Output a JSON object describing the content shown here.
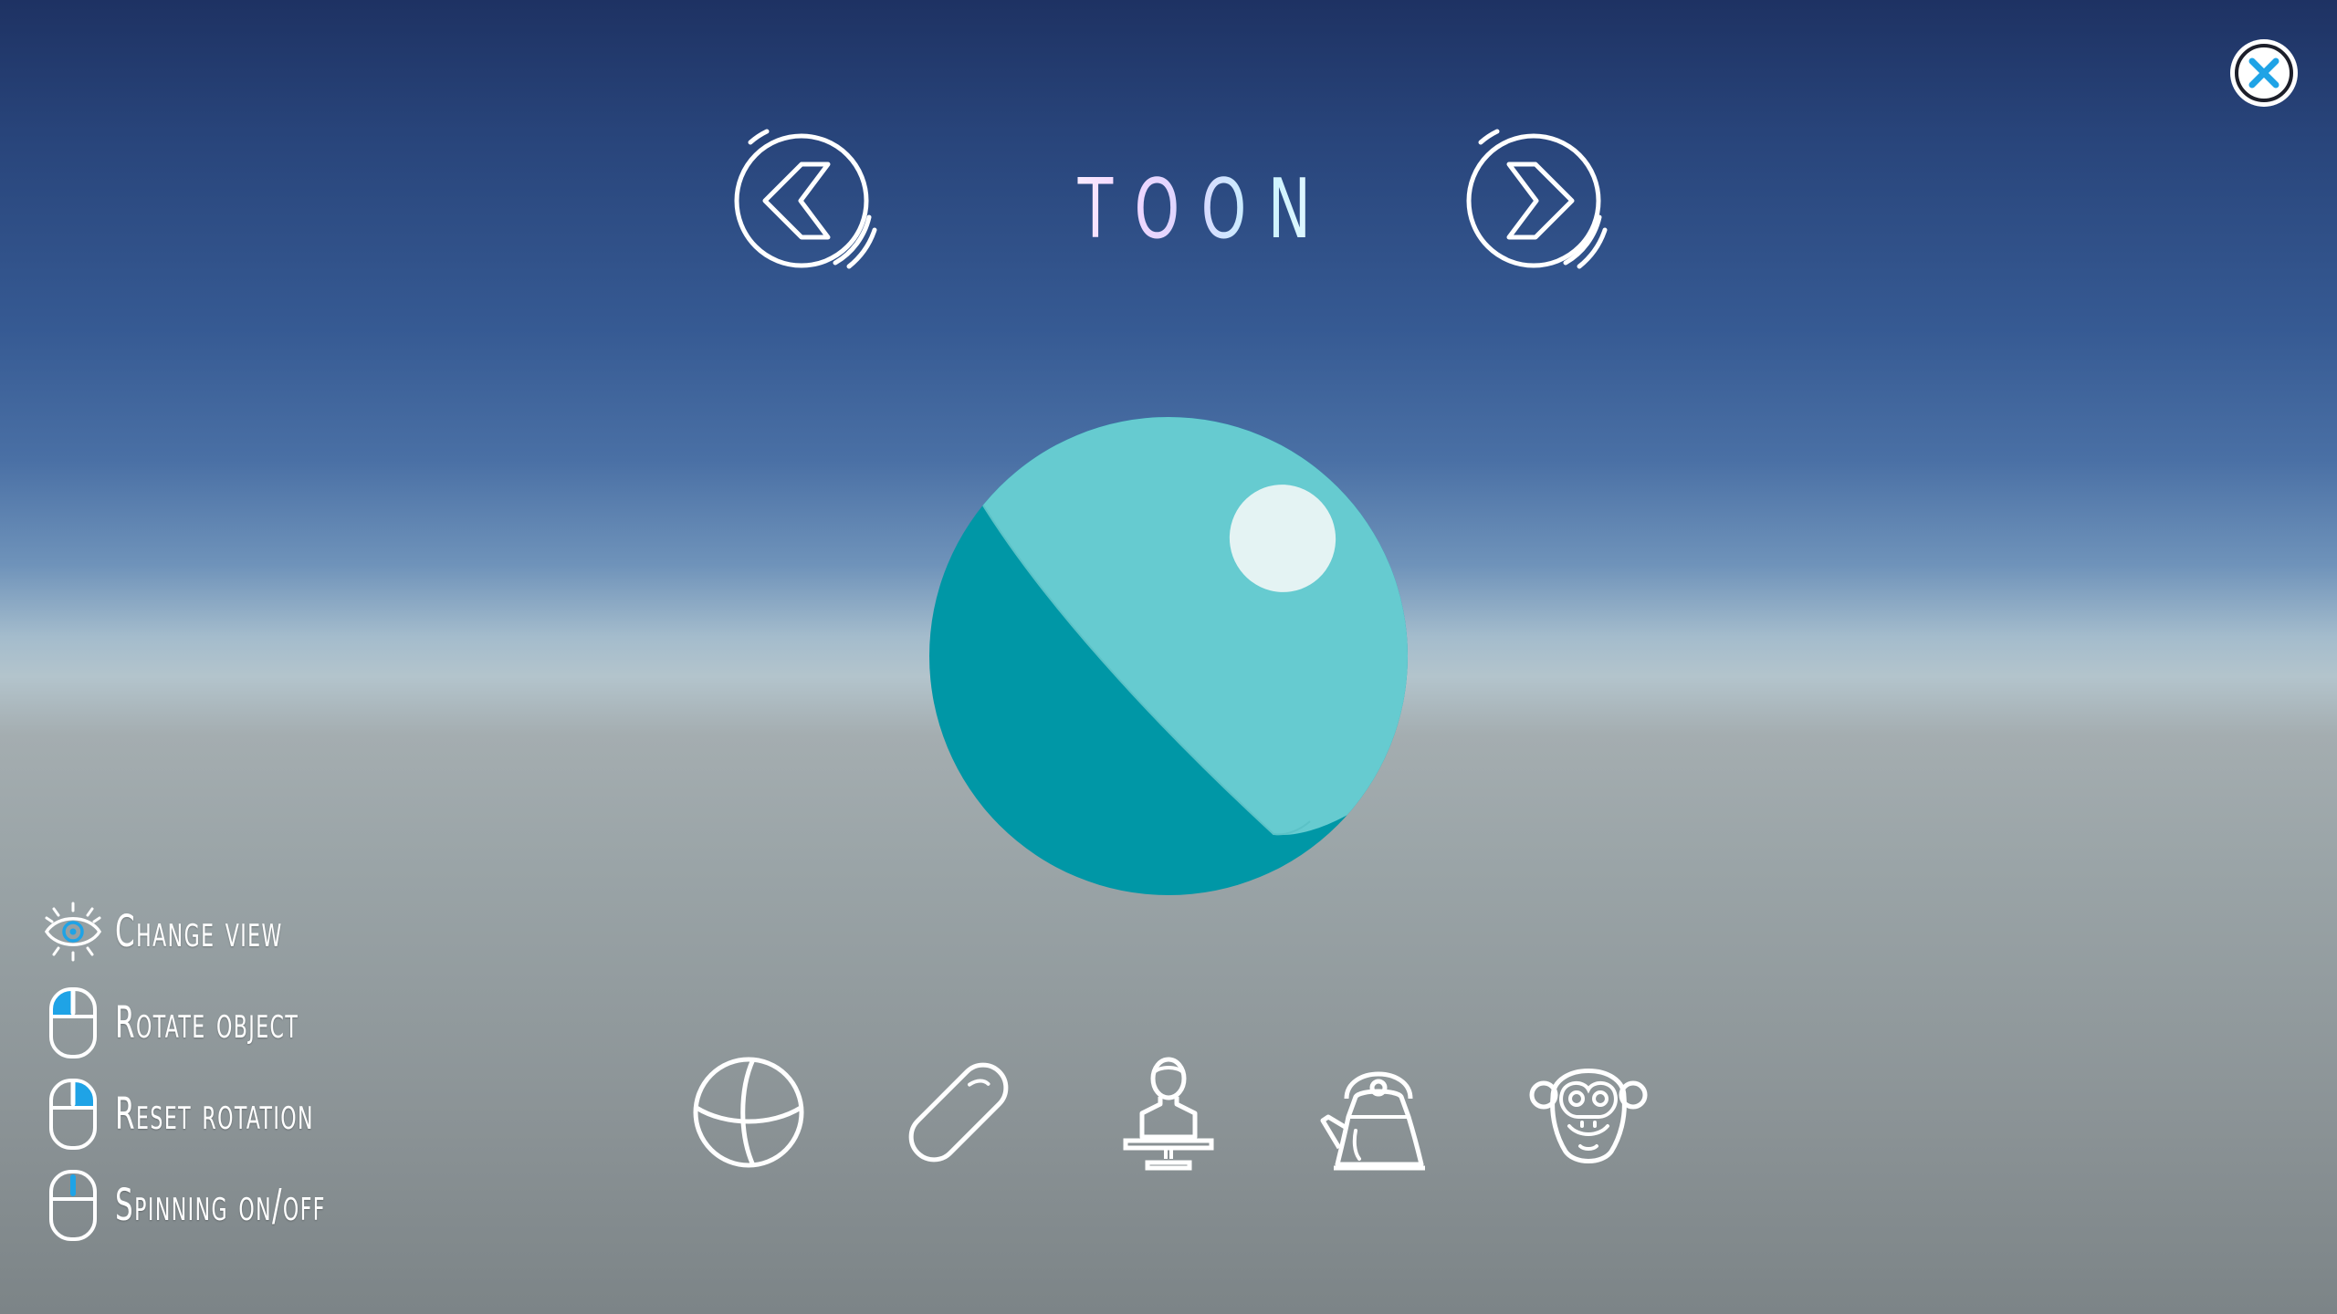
{
  "header": {
    "shader_name": "TOON",
    "prev_label": "",
    "next_label": ""
  },
  "colors": {
    "accent": "#1fa3e6",
    "sphere_light": "#66cbd0",
    "sphere_dark": "#0097a6",
    "highlight": "#e4f3f3",
    "icon_stroke": "#ffffff"
  },
  "preview": {
    "object": "sphere"
  },
  "objects": [
    {
      "icon": "sphere-icon"
    },
    {
      "icon": "capsule-icon"
    },
    {
      "icon": "bust-icon"
    },
    {
      "icon": "teapot-icon"
    },
    {
      "icon": "monkey-icon"
    }
  ],
  "controls": [
    {
      "icon": "eye-icon",
      "label": "Change view"
    },
    {
      "icon": "mouse-left-icon",
      "label": "Rotate object"
    },
    {
      "icon": "mouse-right-icon",
      "label": "Reset rotation"
    },
    {
      "icon": "mouse-middle-icon",
      "label": "Spinning on/off"
    }
  ]
}
